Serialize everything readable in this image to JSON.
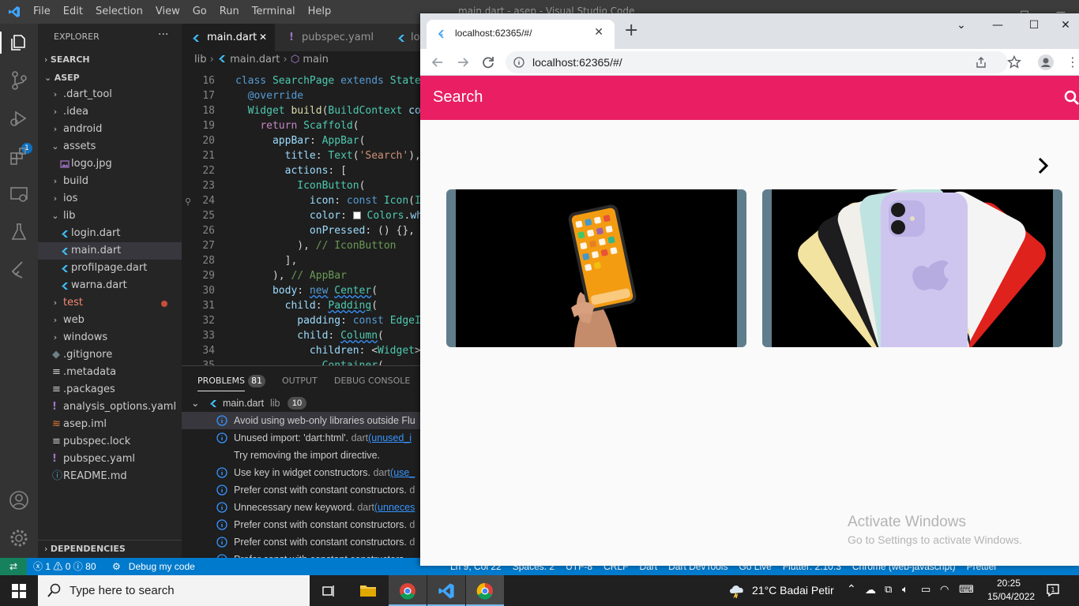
{
  "vscode": {
    "menu": [
      "File",
      "Edit",
      "Selection",
      "View",
      "Go",
      "Run",
      "Terminal",
      "Help"
    ],
    "window_title": "main.dart - asep - Visual Studio Code",
    "activity_badge": "1",
    "explorer": {
      "header": "EXPLORER",
      "more": "···",
      "search_section": "SEARCH",
      "project": "ASEP",
      "items": [
        {
          "label": ".dart_tool",
          "kind": "folder",
          "depth": 1,
          "open": false
        },
        {
          "label": ".idea",
          "kind": "folder",
          "depth": 1,
          "open": false
        },
        {
          "label": "android",
          "kind": "folder",
          "depth": 1,
          "open": false
        },
        {
          "label": "assets",
          "kind": "folder",
          "depth": 1,
          "open": true
        },
        {
          "label": "logo.jpg",
          "kind": "image",
          "depth": 2
        },
        {
          "label": "build",
          "kind": "folder",
          "depth": 1,
          "open": false
        },
        {
          "label": "ios",
          "kind": "folder",
          "depth": 1,
          "open": false
        },
        {
          "label": "lib",
          "kind": "folder",
          "depth": 1,
          "open": true
        },
        {
          "label": "login.dart",
          "kind": "dart",
          "depth": 2
        },
        {
          "label": "main.dart",
          "kind": "dart",
          "depth": 2,
          "selected": true
        },
        {
          "label": "profilpage.dart",
          "kind": "dart",
          "depth": 2
        },
        {
          "label": "warna.dart",
          "kind": "dart",
          "depth": 2
        },
        {
          "label": "test",
          "kind": "folder",
          "depth": 1,
          "open": false,
          "error": true
        },
        {
          "label": "web",
          "kind": "folder",
          "depth": 1,
          "open": false
        },
        {
          "label": "windows",
          "kind": "folder",
          "depth": 1,
          "open": false
        },
        {
          "label": ".gitignore",
          "kind": "git",
          "depth": 1
        },
        {
          "label": ".metadata",
          "kind": "lines",
          "depth": 1
        },
        {
          "label": ".packages",
          "kind": "lines",
          "depth": 1
        },
        {
          "label": "analysis_options.yaml",
          "kind": "yaml",
          "depth": 1
        },
        {
          "label": "asep.iml",
          "kind": "rss",
          "depth": 1
        },
        {
          "label": "pubspec.lock",
          "kind": "lines",
          "depth": 1
        },
        {
          "label": "pubspec.yaml",
          "kind": "yaml",
          "depth": 1
        },
        {
          "label": "README.md",
          "kind": "info",
          "depth": 1
        }
      ],
      "dependencies": "DEPENDENCIES"
    },
    "tabs": [
      {
        "label": "main.dart",
        "active": true,
        "close": "✕"
      },
      {
        "label": "pubspec.yaml",
        "active": false
      },
      {
        "label": "lo",
        "active": false
      }
    ],
    "breadcrumb": {
      "folder": "lib",
      "file": "main.dart",
      "symbol": "main"
    },
    "code_lines": [
      {
        "n": "16",
        "html": "<span class='k'>class</span> <span class='t'>SearchPage</span> <span class='k'>extends</span> <span class='t'>StateI</span>"
      },
      {
        "n": "17",
        "html": "  <span class='k'>@override</span>"
      },
      {
        "n": "18",
        "html": "  <span class='t'>Widget</span> <span class='f'>build</span>(<span class='t'>BuildContext</span> <span class='p'>con</span>"
      },
      {
        "n": "19",
        "html": "    <span class='c'>return</span> <span class='t'>Scaffold</span>("
      },
      {
        "n": "20",
        "html": "      <span class='p'>appBar</span>: <span class='t'>AppBar</span>("
      },
      {
        "n": "21",
        "html": "        <span class='p'>title</span>: <span class='t'>Text</span>(<span class='s'>'Search'</span>),"
      },
      {
        "n": "22",
        "html": "        <span class='p'>actions</span>: ["
      },
      {
        "n": "23",
        "html": "          <span class='t'>IconButton</span>("
      },
      {
        "n": "24",
        "html": "            <span class='p'>icon</span>: <span class='k'>const</span> <span class='t'>Icon</span>(<span class='t'>Ic</span>"
      },
      {
        "n": "25",
        "html": "            <span class='p'>color</span>: <span style='display:inline-block;width:10px;height:10px;background:#fff;border:1px solid #888;vertical-align:-1px'></span> <span class='t'>Colors</span>.<span class='p'>wh</span>"
      },
      {
        "n": "26",
        "html": "            <span class='p'>onPressed</span>: () {},"
      },
      {
        "n": "27",
        "html": "          ), <span class='cm'>// IconButton</span>"
      },
      {
        "n": "28",
        "html": "        ],"
      },
      {
        "n": "29",
        "html": "      ), <span class='cm'>// AppBar</span>"
      },
      {
        "n": "30",
        "html": "      <span class='p'>body</span>: <span class='k wav'>new</span> <span class='t wav'>Center</span>("
      },
      {
        "n": "31",
        "html": "        <span class='p'>child</span>: <span class='t wav'>Padding</span>("
      },
      {
        "n": "32",
        "html": "          <span class='p'>padding</span>: <span class='k'>const</span> <span class='t'>EdgeIn</span>"
      },
      {
        "n": "33",
        "html": "          <span class='p'>child</span>: <span class='t wav'>Column</span>("
      },
      {
        "n": "34",
        "html": "            <span class='p'>children</span>: &lt;<span class='t'>Widget</span>&gt;["
      },
      {
        "n": "35",
        "html": "              <span class='t'>Container</span>("
      }
    ],
    "panel": {
      "tabs": [
        {
          "label": "PROBLEMS",
          "active": true,
          "badge": "81"
        },
        {
          "label": "OUTPUT",
          "active": false
        },
        {
          "label": "DEBUG CONSOLE",
          "active": false
        }
      ],
      "group": {
        "file": "main.dart",
        "folder": "lib",
        "count": "10"
      },
      "problems": [
        {
          "msg": "Avoid using web-only libraries outside Flu",
          "src": "",
          "link": "",
          "selected": true
        },
        {
          "msg": "Unused import: 'dart:html'.",
          "src": "dart",
          "link": "(unused_i"
        },
        {
          "msg": "Try removing the import directive.",
          "src": "",
          "link": "",
          "hint": true
        },
        {
          "msg": "Use key in widget constructors.",
          "src": "dart",
          "link": "(use_"
        },
        {
          "msg": "Prefer const with constant constructors.",
          "src": "d",
          "link": ""
        },
        {
          "msg": "Unnecessary new keyword.",
          "src": "dart",
          "link": "(unneces"
        },
        {
          "msg": "Prefer const with constant constructors.",
          "src": "d",
          "link": ""
        },
        {
          "msg": "Prefer const with constant constructors.",
          "src": "d",
          "link": ""
        },
        {
          "msg": "Prefer const with constant constructors.",
          "src": "",
          "link": ""
        }
      ]
    },
    "statusbar": {
      "errors": "1",
      "warnings": "0",
      "infos": "80",
      "debug": "Debug my code",
      "right": [
        "Ln 9, Col 22",
        "Spaces: 2",
        "UTF-8",
        "CRLF",
        "Dart",
        "Dart DevTools",
        "Go Live",
        "Flutter: 2.10.3",
        "Chrome (web-javascript)",
        "Prettier"
      ]
    }
  },
  "chrome": {
    "tab_title": "localhost:62365/#/",
    "tab_close": "✕",
    "new_tab": "+",
    "url": "localhost:62365/#/",
    "controls": [
      "⌄",
      "—",
      "☐",
      "✕"
    ]
  },
  "app": {
    "title": "Search",
    "next_icon": "chevron-right-icon",
    "colors": {
      "appbar": "#e91e63",
      "card": "#607d8b"
    },
    "cards": [
      {
        "name": "phone-in-hand-photo"
      },
      {
        "name": "iphone-11-fan-photo"
      }
    ]
  },
  "watermark": {
    "line1": "Activate Windows",
    "line2": "Go to Settings to activate Windows."
  },
  "taskbar": {
    "search_placeholder": "Type here to search",
    "weather": "21°C  Badai Petir",
    "time": "20:25",
    "date": "15/04/2022"
  }
}
